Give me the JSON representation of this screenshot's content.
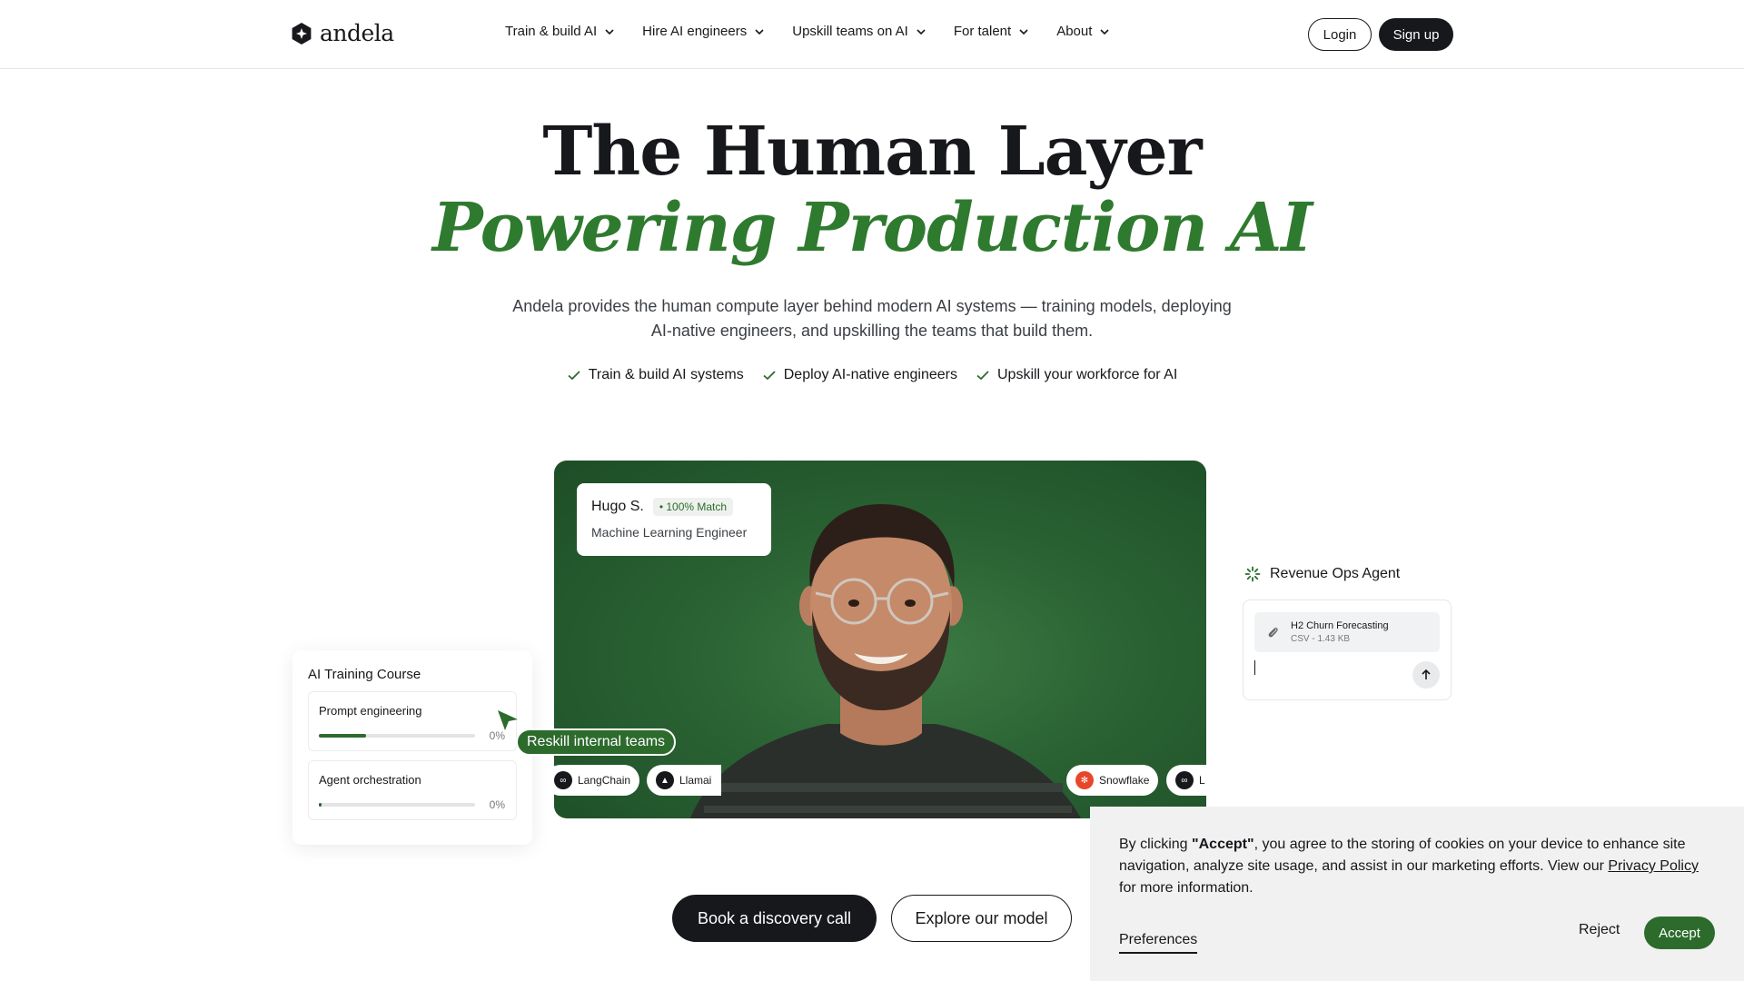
{
  "header": {
    "logo_text": "andela",
    "nav": [
      {
        "label": "Train & build AI"
      },
      {
        "label": "Hire AI engineers"
      },
      {
        "label": "Upskill teams on AI"
      },
      {
        "label": "For talent"
      },
      {
        "label": "About"
      }
    ],
    "login_label": "Login",
    "signup_label": "Sign up"
  },
  "hero": {
    "title_line1": "The Human Layer",
    "title_line2": "Powering Production AI",
    "description": "Andela provides the human compute layer behind modern AI systems — training models, deploying AI-native engineers, and upskilling the teams that build them.",
    "features": [
      "Train & build AI systems",
      "Deploy AI-native engineers",
      "Upskill your workforce for AI"
    ]
  },
  "video_card": {
    "match": {
      "name": "Hugo S.",
      "badge": "• 100% Match",
      "role": "Machine Learning Engineer"
    },
    "tags": [
      "LangChain",
      "Llamai",
      "Snowflake",
      "L"
    ]
  },
  "training": {
    "title": "AI Training Course",
    "courses": [
      {
        "name": "Prompt engineering",
        "progress": 0.3,
        "pct_label": "0%"
      },
      {
        "name": "Agent orchestration",
        "progress": 0.02,
        "pct_label": "0%"
      }
    ],
    "reskill_label": "Reskill internal teams"
  },
  "agent": {
    "title": "Revenue Ops Agent",
    "file_name": "H2 Churn Forecasting",
    "file_meta": "CSV - 1.43 KB"
  },
  "cta": {
    "primary": "Book a discovery call",
    "secondary": "Explore our model"
  },
  "cookie": {
    "text_prefix": "By clicking ",
    "text_bold": "\"Accept\"",
    "text_mid": ", you agree to the storing of cookies on your device to enhance site navigation, analyze site usage, and assist in our marketing efforts. View our ",
    "privacy_link": "Privacy Policy",
    "text_suffix": " for more information.",
    "preferences": "Preferences",
    "reject": "Reject",
    "accept": "Accept"
  },
  "colors": {
    "brand_green": "#2d6b2d",
    "dark": "#16181b"
  }
}
